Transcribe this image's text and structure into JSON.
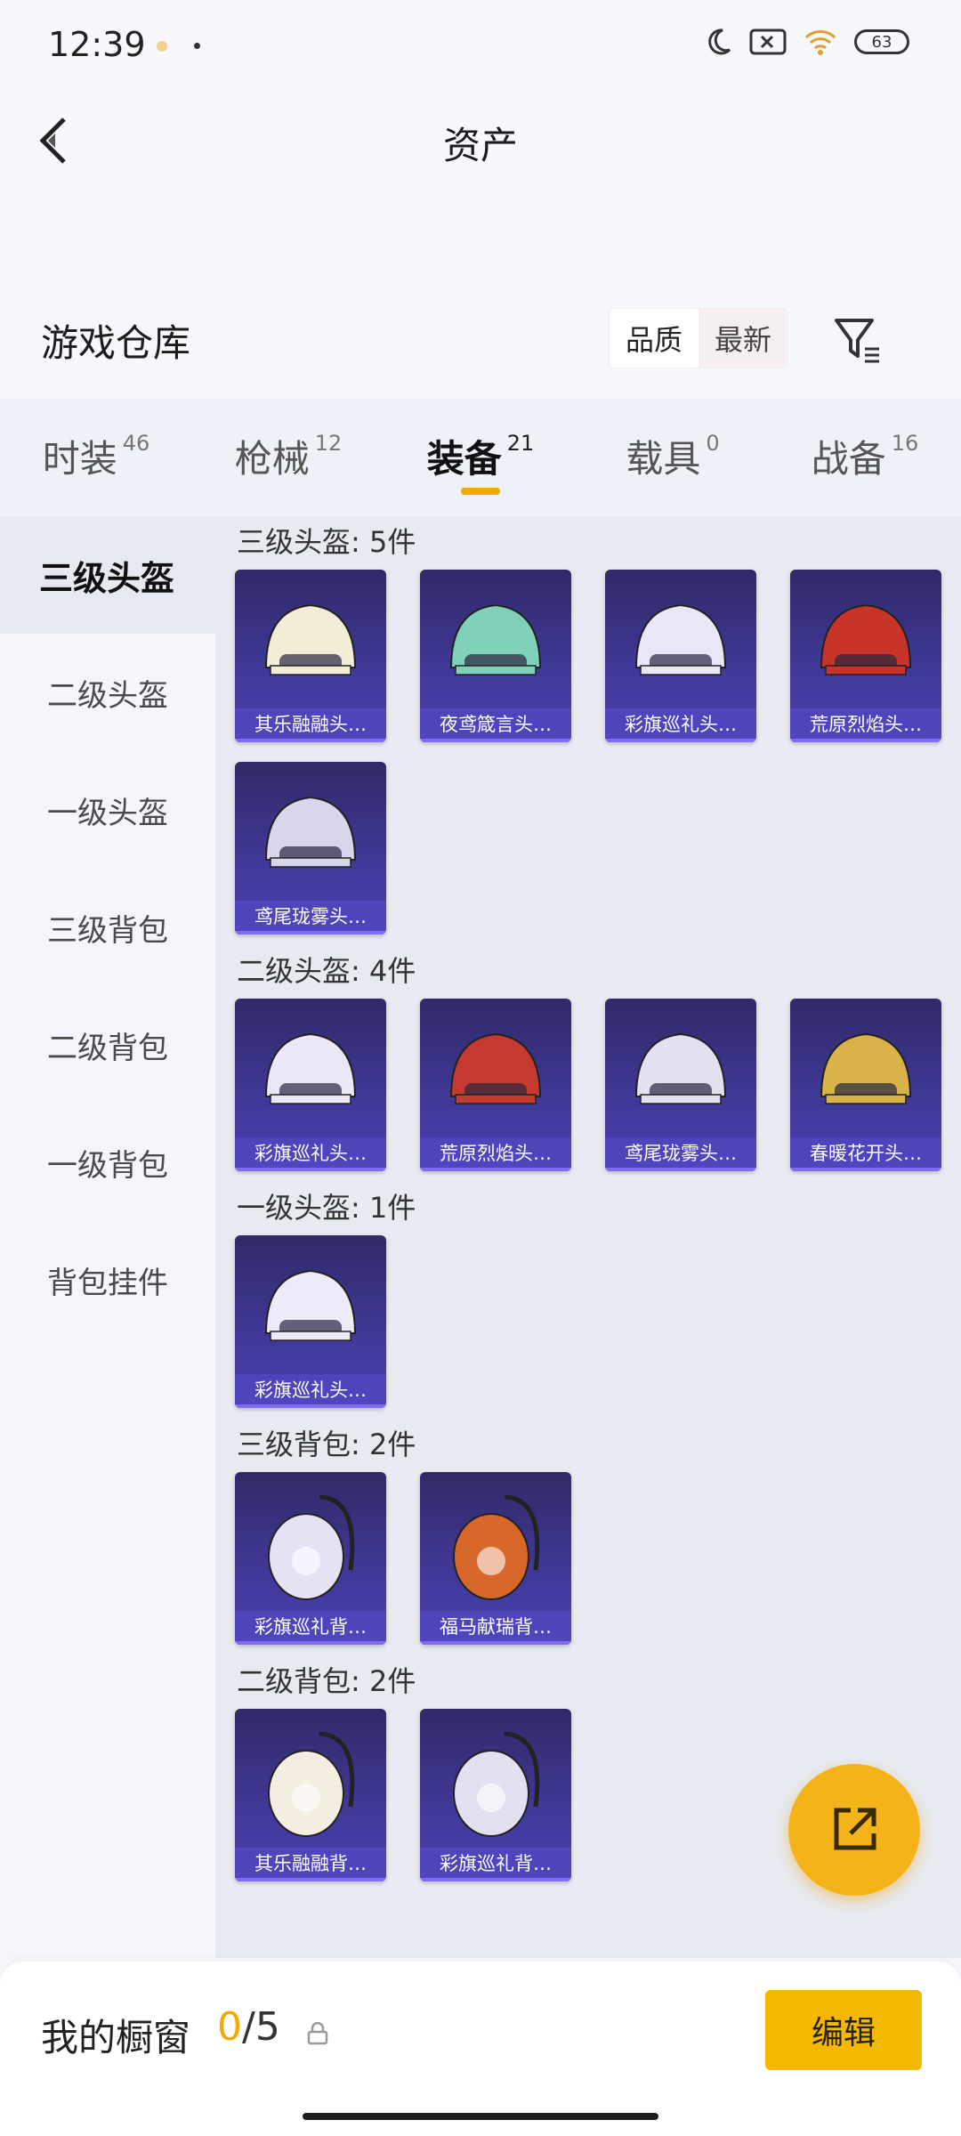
{
  "status": {
    "time": "12:39",
    "battery": "63"
  },
  "header": {
    "title": "资产"
  },
  "warehouse": {
    "title": "游戏仓库",
    "sort_quality": "品质",
    "sort_newest": "最新"
  },
  "tabs": [
    {
      "label": "时装",
      "count": "46"
    },
    {
      "label": "枪械",
      "count": "12"
    },
    {
      "label": "装备",
      "count": "21",
      "active": true
    },
    {
      "label": "载具",
      "count": "0"
    },
    {
      "label": "战备",
      "count": "16"
    }
  ],
  "sidebar": {
    "items": [
      {
        "label": "三级头盔",
        "active": true
      },
      {
        "label": "二级头盔"
      },
      {
        "label": "一级头盔"
      },
      {
        "label": "三级背包"
      },
      {
        "label": "二级背包"
      },
      {
        "label": "一级背包"
      },
      {
        "label": "背包挂件"
      }
    ]
  },
  "sections": [
    {
      "title": "三级头盔: 5件",
      "items": [
        {
          "label": "其乐融融头…",
          "kind": "helmet",
          "color": "#f3ecd6"
        },
        {
          "label": "夜鸢箴言头…",
          "kind": "helmet",
          "color": "#7fd1b9"
        },
        {
          "label": "彩旗巡礼头…",
          "kind": "helmet",
          "color": "#e9e6f7"
        },
        {
          "label": "荒原烈焰头…",
          "kind": "helmet",
          "color": "#c8342a"
        },
        {
          "label": "鸢尾珑雾头…",
          "kind": "helmet",
          "color": "#d8d6ea"
        }
      ]
    },
    {
      "title": "二级头盔: 4件",
      "items": [
        {
          "label": "彩旗巡礼头…",
          "kind": "helmet",
          "color": "#ebe7f6"
        },
        {
          "label": "荒原烈焰头…",
          "kind": "helmet",
          "color": "#c43a2e"
        },
        {
          "label": "鸢尾珑雾头…",
          "kind": "helmet",
          "color": "#e3e1f0"
        },
        {
          "label": "春暖花开头…",
          "kind": "helmet",
          "color": "#d9b24a"
        }
      ]
    },
    {
      "title": "一级头盔: 1件",
      "items": [
        {
          "label": "彩旗巡礼头…",
          "kind": "helmet",
          "color": "#eeeaf8"
        }
      ]
    },
    {
      "title": "三级背包: 2件",
      "items": [
        {
          "label": "彩旗巡礼背…",
          "kind": "backpack",
          "color": "#e6e2f4"
        },
        {
          "label": "福马献瑞背…",
          "kind": "backpack",
          "color": "#d8682a"
        }
      ]
    },
    {
      "title": "二级背包: 2件",
      "items": [
        {
          "label": "其乐融融背…",
          "kind": "backpack",
          "color": "#f4eee0"
        },
        {
          "label": "彩旗巡礼背…",
          "kind": "backpack",
          "color": "#e3e0f2"
        }
      ]
    }
  ],
  "bottom": {
    "label": "我的橱窗",
    "current": "0",
    "total": "/5",
    "edit": "编辑"
  },
  "colors": {
    "accent": "#f5b800",
    "card_bg": "#3f3895"
  }
}
